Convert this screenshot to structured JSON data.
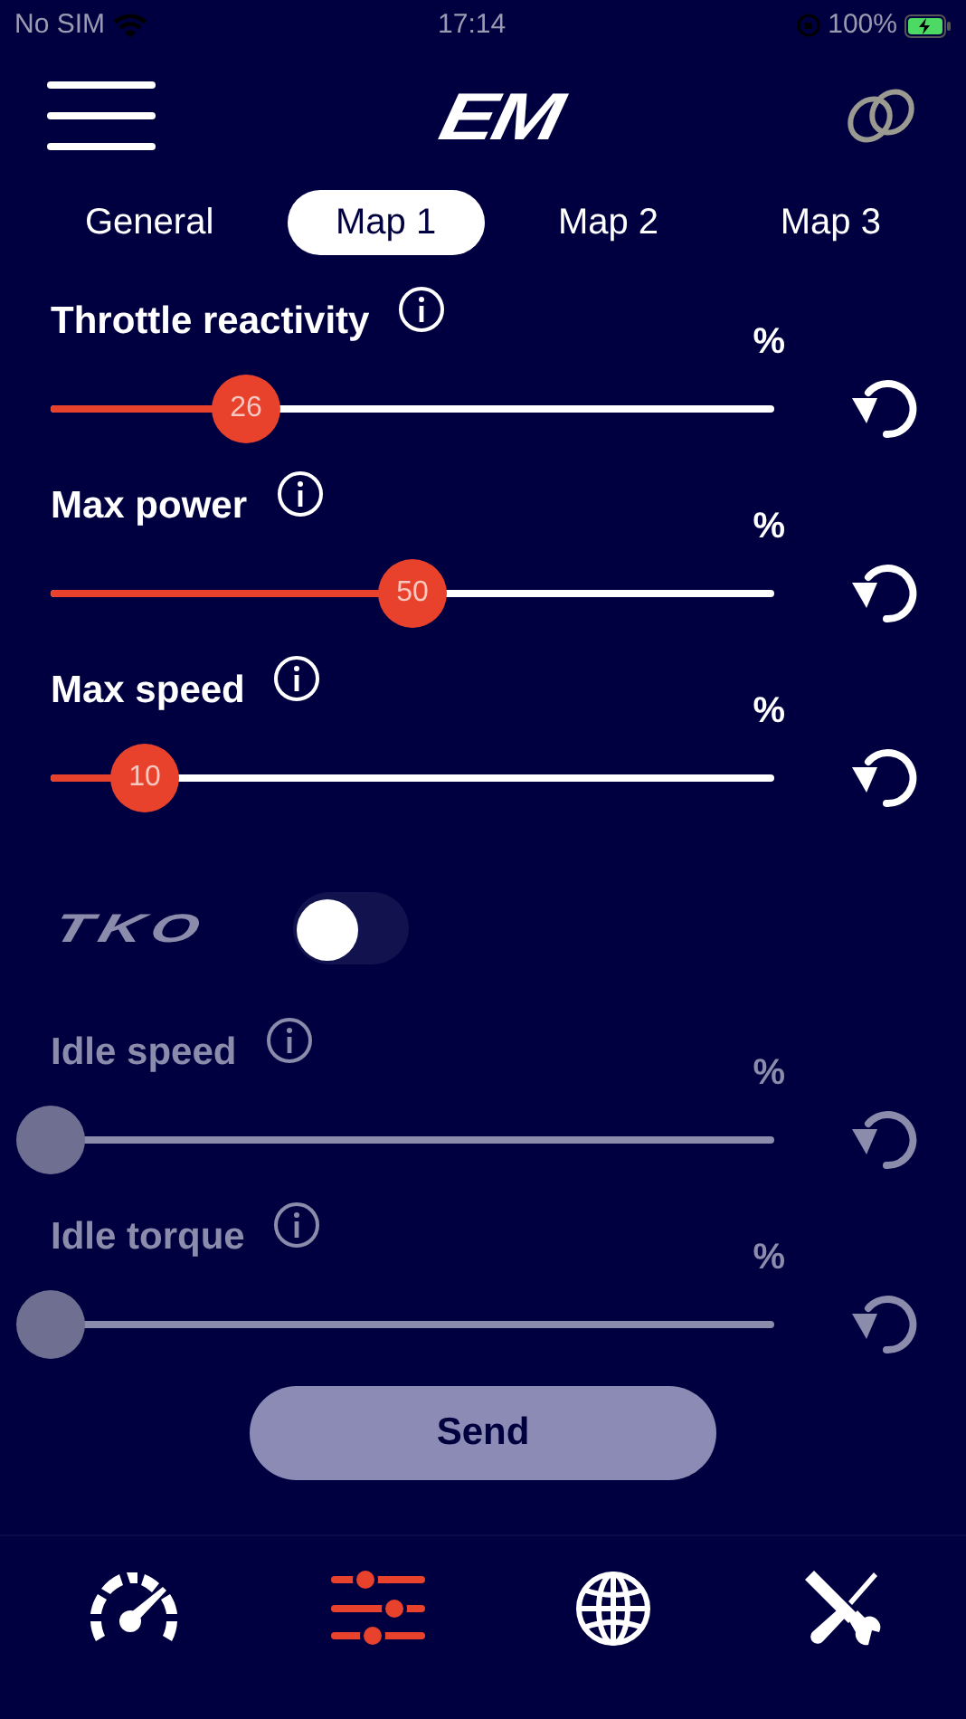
{
  "status_bar": {
    "carrier": "No SIM",
    "time": "17:14",
    "battery": "100%"
  },
  "header": {
    "logo": "EM"
  },
  "tabs": [
    {
      "label": "General",
      "selected": false
    },
    {
      "label": "Map 1",
      "selected": true
    },
    {
      "label": "Map 2",
      "selected": false
    },
    {
      "label": "Map 3",
      "selected": false
    }
  ],
  "sliders": [
    {
      "label": "Throttle reactivity",
      "unit": "%",
      "value": "26",
      "level": 0.27,
      "disabled": false
    },
    {
      "label": "Max power",
      "unit": "%",
      "value": "50",
      "level": 0.5,
      "disabled": false
    },
    {
      "label": "Max speed",
      "unit": "%",
      "value": "10",
      "level": 0.13,
      "disabled": false
    }
  ],
  "tko": {
    "logo": "TKO",
    "on": false
  },
  "idle_sliders": [
    {
      "label": "Idle speed",
      "unit": "%",
      "level": 0,
      "disabled": true
    },
    {
      "label": "Idle torque",
      "unit": "%",
      "level": 0,
      "disabled": true
    }
  ],
  "send_button": {
    "label": "Send",
    "disabled": true
  },
  "bottom_nav": [
    {
      "kind": "gauge",
      "selected": false
    },
    {
      "kind": "sliders",
      "selected": true
    },
    {
      "kind": "globe",
      "selected": false
    },
    {
      "kind": "tools",
      "selected": false
    }
  ]
}
